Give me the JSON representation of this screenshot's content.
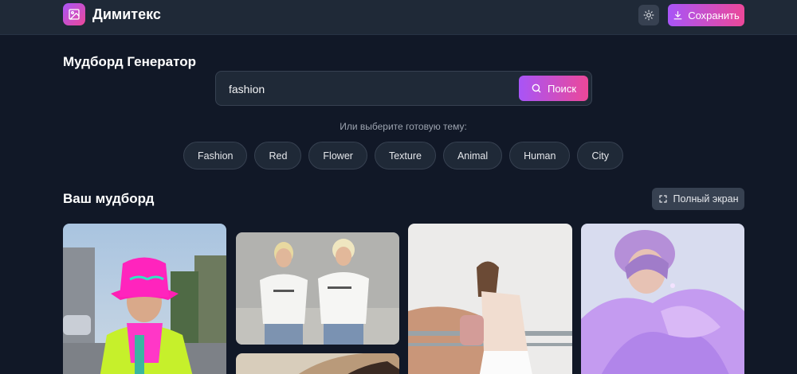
{
  "header": {
    "brand": "Димитекс",
    "save_label": "Сохранить"
  },
  "generator": {
    "title": "Мудборд Генератор",
    "search_value": "fashion",
    "search_button": "Поиск",
    "hint": "Или выберите готовую тему:",
    "themes": [
      "Fashion",
      "Red",
      "Flower",
      "Texture",
      "Animal",
      "Human",
      "City"
    ]
  },
  "board": {
    "title": "Ваш мудборд",
    "fullscreen_label": "Полный экран"
  },
  "icons": {
    "logo": "image-icon",
    "theme": "sun-icon",
    "save": "download-icon",
    "search": "search-icon",
    "fullscreen": "expand-icon"
  },
  "colors": {
    "background": "#111827",
    "surface": "#1f2937",
    "accent_start": "#a855f7",
    "accent_end": "#ec4899"
  }
}
